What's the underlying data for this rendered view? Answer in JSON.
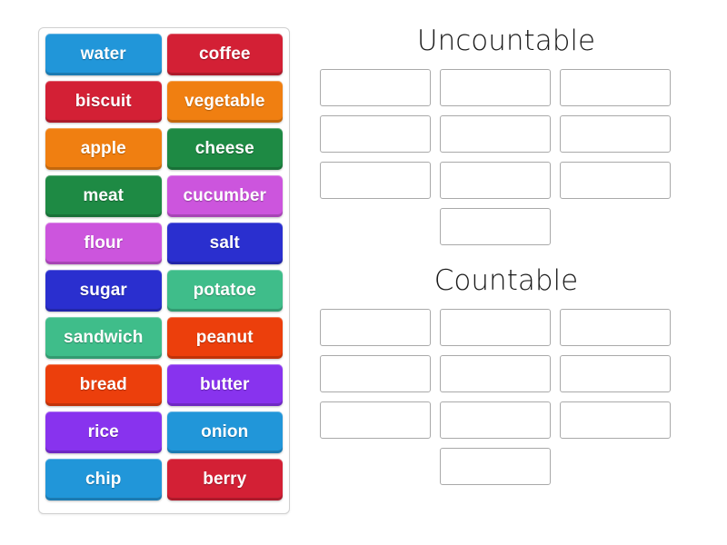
{
  "activity": {
    "type": "group-sort",
    "word_panel": {
      "name": "word-tiles",
      "tiles": [
        {
          "label": "water",
          "color": "#2196d9"
        },
        {
          "label": "coffee",
          "color": "#d32035"
        },
        {
          "label": "biscuit",
          "color": "#d32035"
        },
        {
          "label": "vegetable",
          "color": "#f07f11"
        },
        {
          "label": "apple",
          "color": "#f07f11"
        },
        {
          "label": "cheese",
          "color": "#1e8a44"
        },
        {
          "label": "meat",
          "color": "#1e8a44"
        },
        {
          "label": "cucumber",
          "color": "#cc55dd"
        },
        {
          "label": "flour",
          "color": "#cc55dd"
        },
        {
          "label": "salt",
          "color": "#2a2fcf"
        },
        {
          "label": "sugar",
          "color": "#2a2fcf"
        },
        {
          "label": "potatoe",
          "color": "#3fbd8a"
        },
        {
          "label": "sandwich",
          "color": "#3fbd8a"
        },
        {
          "label": "peanut",
          "color": "#ec3f0c"
        },
        {
          "label": "bread",
          "color": "#ec3f0c"
        },
        {
          "label": "butter",
          "color": "#8833ee"
        },
        {
          "label": "rice",
          "color": "#8833ee"
        },
        {
          "label": "onion",
          "color": "#2196d9"
        },
        {
          "label": "chip",
          "color": "#2196d9"
        },
        {
          "label": "berry",
          "color": "#d32035"
        }
      ]
    },
    "groups": [
      {
        "id": "uncountable",
        "heading": "Uncountable",
        "slot_count": 10,
        "slots": [
          "",
          "",
          "",
          "",
          "",
          "",
          "",
          "",
          "",
          ""
        ]
      },
      {
        "id": "countable",
        "heading": "Countable",
        "slot_count": 10,
        "slots": [
          "",
          "",
          "",
          "",
          "",
          "",
          "",
          "",
          "",
          ""
        ]
      }
    ],
    "colors": {
      "page_background": "#ffffff",
      "panel_border": "#d0d0d0",
      "slot_border": "#a9a9a9",
      "heading_text": "#1a1a1a",
      "tile_text": "#ffffff"
    }
  }
}
